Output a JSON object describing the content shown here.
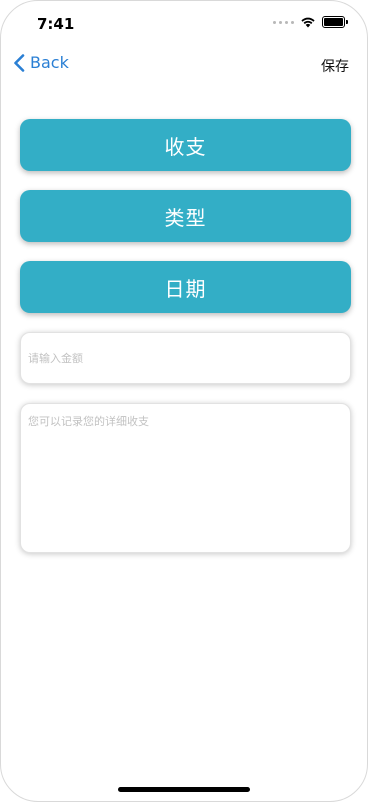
{
  "status_bar": {
    "time": "7:41",
    "icons": [
      "signal-dots-icon",
      "wifi-icon",
      "battery-icon"
    ]
  },
  "nav": {
    "back_label": "Back",
    "save_label": "保存"
  },
  "buttons": {
    "income_expense": "收支",
    "category": "类型",
    "date": "日期"
  },
  "form": {
    "amount_placeholder": "请输入金额",
    "amount_value": "",
    "note_placeholder": "您可以记录您的详细收支",
    "note_value": ""
  },
  "colors": {
    "accent": "#33aec6",
    "link": "#2a7fd4"
  }
}
